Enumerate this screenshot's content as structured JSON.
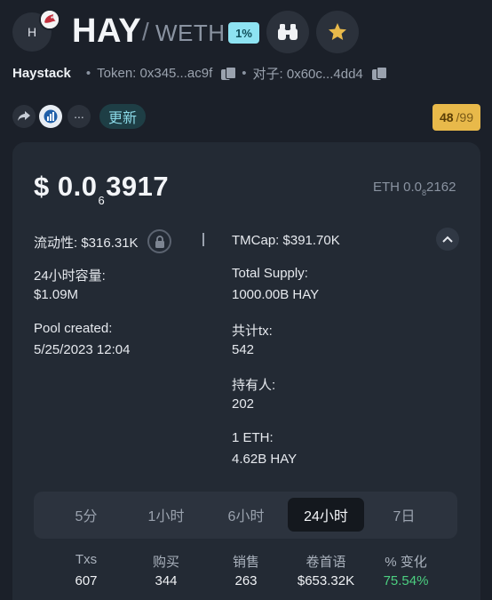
{
  "header": {
    "avatar_letter": "H",
    "symbol": "HAY",
    "slash": "/",
    "quote": "WETH",
    "fee_badge": "1%",
    "binoculars_icon": "binoculars-icon",
    "star_icon": "star-icon"
  },
  "token_line": {
    "name": "Haystack",
    "token_label": "Token: 0x345...ac9f",
    "pair_label": "对子: 0x60c...4dd4"
  },
  "actions": {
    "update_label": "更新",
    "more_label": "...",
    "score_value": "48",
    "score_total": "/99"
  },
  "price": {
    "dollar_prefix": "$ 0.0",
    "dollar_sub": "6",
    "dollar_tail": "3917",
    "eth_prefix": "ETH 0.0",
    "eth_sub": "8",
    "eth_tail": "2162"
  },
  "details": {
    "liquidity": "流动性: $316.31K",
    "tmcap": "TMCap: $391.70K",
    "volume_label": "24小时容量:",
    "volume_value": "$1.09M",
    "supply_label": "Total Supply:",
    "supply_value": "1000.00B HAY",
    "pool_label": "Pool created:",
    "pool_value": "5/25/2023 12:04",
    "tx_label": "共计tx:",
    "tx_value": "542",
    "holders_label": "持有人:",
    "holders_value": "202",
    "eth_label": "1 ETH:",
    "eth_value": "4.62B HAY"
  },
  "tabs": [
    {
      "label": "5分"
    },
    {
      "label": "1小时"
    },
    {
      "label": "6小时"
    },
    {
      "label": "24小时",
      "active": true
    },
    {
      "label": "7日"
    }
  ],
  "stats": [
    {
      "header": "Txs",
      "value": "607"
    },
    {
      "header": "购买",
      "value": "344"
    },
    {
      "header": "销售",
      "value": "263"
    },
    {
      "header": "卷首语",
      "value": "$653.32K"
    },
    {
      "header": "% 变化",
      "value": "75.54%"
    }
  ],
  "colors": {
    "background": "#1b2029",
    "card": "#232a34",
    "fee_badge": "#8ee3f2",
    "score_badge": "#e8b94a",
    "star": "#e8b94a",
    "positive": "#4ccf80"
  }
}
